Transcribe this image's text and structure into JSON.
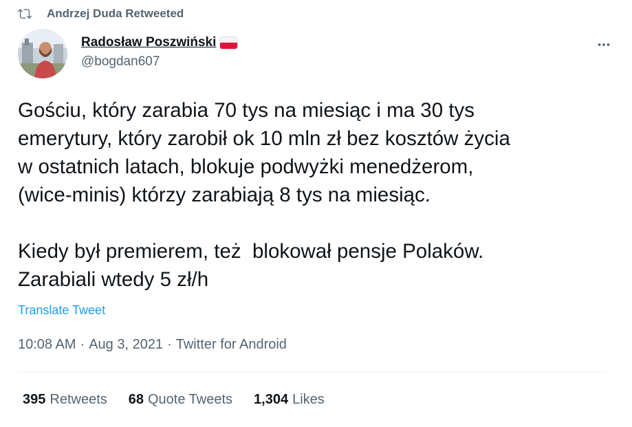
{
  "retweet": {
    "label": "Andrzej Duda Retweeted"
  },
  "author": {
    "display_name": "Radosław Poszwiński",
    "handle": "@bogdan607",
    "flag": {
      "top": "#f4f4f4",
      "bottom": "#dc143c"
    }
  },
  "tweet": {
    "lines_p1": [
      "Gościu, który zarabia 70 tys na miesiąc i ma 30 tys",
      "emerytury, który zarobił ok 10 mln zł bez kosztów życia",
      "w ostatnich latach, blokuje podwyżki menedżerom,",
      "(wice-minis) którzy zarabiają 8 tys na miesiąc."
    ],
    "lines_p2": [
      "Kiedy był premierem, też  blokował pensje Polaków.",
      "Zarabiali wtedy 5 zł/h"
    ],
    "translate_label": "Translate Tweet"
  },
  "meta": {
    "time": "10:08 AM",
    "date": "Aug 3, 2021",
    "source": "Twitter for Android",
    "separator": "·"
  },
  "stats": {
    "retweets_count": "395",
    "retweets_label": "Retweets",
    "quotes_count": "68",
    "quotes_label": "Quote Tweets",
    "likes_count": "1,304",
    "likes_label": "Likes"
  },
  "colors": {
    "accent": "#1d9bf0",
    "text": "#0f1419",
    "muted": "#536471"
  }
}
